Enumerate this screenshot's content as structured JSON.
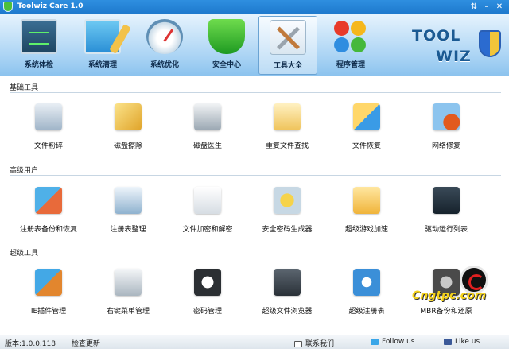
{
  "window": {
    "title": "Toolwiz Care 1.0"
  },
  "nav": [
    {
      "label": "系统体检",
      "icon": "monitor-icon"
    },
    {
      "label": "系统清理",
      "icon": "clean-icon"
    },
    {
      "label": "系统优化",
      "icon": "gauge-icon"
    },
    {
      "label": "安全中心",
      "icon": "shield-icon"
    },
    {
      "label": "工具大全",
      "icon": "tools-icon",
      "active": true
    },
    {
      "label": "程序管理",
      "icon": "apps-icon"
    }
  ],
  "brand": {
    "line1": "TOOL",
    "line2": "WIZ"
  },
  "sections": [
    {
      "title": "基础工具",
      "tools": [
        {
          "label": "文件粉碎",
          "icon": "shredder-icon"
        },
        {
          "label": "磁盘擦除",
          "icon": "disk-wipe-icon"
        },
        {
          "label": "磁盘医生",
          "icon": "disk-doctor-icon"
        },
        {
          "label": "重复文件查找",
          "icon": "duplicate-finder-icon"
        },
        {
          "label": "文件恢复",
          "icon": "file-recovery-icon"
        },
        {
          "label": "网络修复",
          "icon": "network-repair-icon"
        }
      ]
    },
    {
      "title": "高级用户",
      "tools": [
        {
          "label": "注册表备份和恢复",
          "icon": "registry-backup-icon"
        },
        {
          "label": "注册表整理",
          "icon": "registry-defrag-icon"
        },
        {
          "label": "文件加密和解密",
          "icon": "file-encrypt-icon"
        },
        {
          "label": "安全密码生成器",
          "icon": "password-generator-icon"
        },
        {
          "label": "超级游戏加速",
          "icon": "game-booster-icon"
        },
        {
          "label": "驱动运行列表",
          "icon": "driver-list-icon"
        }
      ]
    },
    {
      "title": "超级工具",
      "tools": [
        {
          "label": "IE插件管理",
          "icon": "ie-plugin-icon"
        },
        {
          "label": "右键菜单管理",
          "icon": "context-menu-icon"
        },
        {
          "label": "密码管理",
          "icon": "password-manager-icon"
        },
        {
          "label": "超级文件浏览器",
          "icon": "file-browser-icon"
        },
        {
          "label": "超级注册表",
          "icon": "super-registry-icon"
        },
        {
          "label": "MBR备份和还原",
          "icon": "mbr-backup-icon"
        }
      ]
    }
  ],
  "watermark": {
    "text": "Cngtpc.com"
  },
  "statusbar": {
    "version": "版本:1.0.0.118",
    "check_update": "检查更新",
    "contact": "联系我们",
    "follow": "Follow us",
    "like": "Like us"
  },
  "colors": {
    "accent": "#1d78cc",
    "header_bg": "#a9d3f4",
    "active_tab": "#bcdcf5"
  }
}
